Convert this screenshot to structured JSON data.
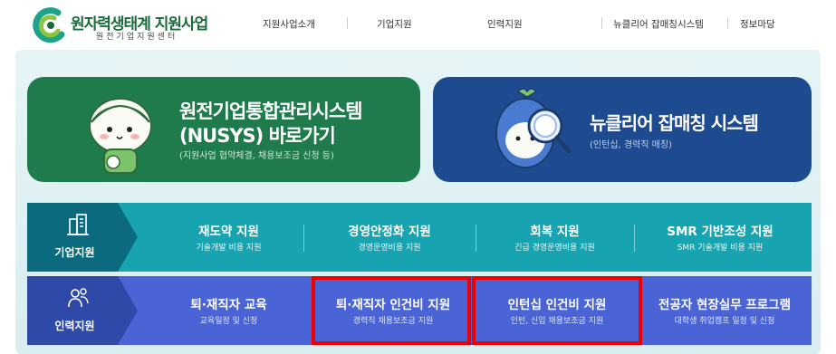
{
  "header": {
    "logo_title": "원자력생태계 지원사업",
    "logo_sub": "원전기업지원센터",
    "nav": [
      {
        "label": "지원사업소개"
      },
      {
        "label": "기업지원"
      },
      {
        "label": "인력지원"
      },
      {
        "label": "뉴클리어 잡매칭시스템"
      },
      {
        "label": "정보마당"
      }
    ]
  },
  "banners": {
    "nusys": {
      "title_line1": "원전기업통합관리시스템",
      "title_line2": "(NUSYS) 바로가기",
      "subtitle": "(지원사업 협약체결, 채용보조금 신청 등)",
      "color": "#1f7a4c"
    },
    "jobmatch": {
      "title": "뉴클리어 잡매칭 시스템",
      "subtitle": "(인턴십, 경력직 매칭)",
      "color": "#1e4b8f"
    }
  },
  "enterprise": {
    "label": "기업지원",
    "items": [
      {
        "title": "재도약 지원",
        "sub": "기술개발 비용 지원"
      },
      {
        "title": "경영안정화 지원",
        "sub": "경영운영비용 지원"
      },
      {
        "title": "회복 지원",
        "sub": "긴급 경영운영비용 지원"
      },
      {
        "title": "SMR 기반조성 지원",
        "sub": "SMR 기술개발 비용 지원"
      }
    ]
  },
  "hr": {
    "label": "인력지원",
    "items": [
      {
        "title": "퇴·재직자 교육",
        "sub": "교육일정 및 신청"
      },
      {
        "title": "퇴·재직자 인건비 지원",
        "sub": "경력직 채용보조금 지원",
        "highlighted": true
      },
      {
        "title": "인턴십 인건비 지원",
        "sub": "인턴, 신입 채용보조금 지원",
        "highlighted": true
      },
      {
        "title": "전공자 현장실무 프로그램",
        "sub": "대학생 취업캠프 일정 및 신청"
      }
    ]
  },
  "colors": {
    "enterprise_row": "#17a4b0",
    "hr_row": "#4a64d6",
    "highlight": "#ee0000"
  }
}
